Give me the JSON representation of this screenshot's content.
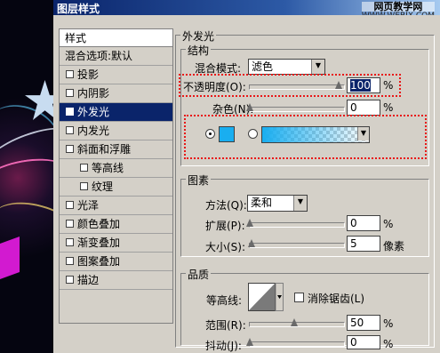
{
  "window": {
    "title": "图层样式"
  },
  "watermark": {
    "line1": "网页教学网",
    "line2": "WWW.WEBJX.COM"
  },
  "styles_list": {
    "header": "样式",
    "items": [
      {
        "label": "混合选项:默认",
        "checkbox": false,
        "checked": false,
        "indent": false,
        "selected": false
      },
      {
        "label": "投影",
        "checkbox": true,
        "checked": false,
        "indent": false,
        "selected": false
      },
      {
        "label": "内阴影",
        "checkbox": true,
        "checked": false,
        "indent": false,
        "selected": false
      },
      {
        "label": "外发光",
        "checkbox": true,
        "checked": true,
        "indent": false,
        "selected": true
      },
      {
        "label": "内发光",
        "checkbox": true,
        "checked": false,
        "indent": false,
        "selected": false
      },
      {
        "label": "斜面和浮雕",
        "checkbox": true,
        "checked": false,
        "indent": false,
        "selected": false
      },
      {
        "label": "等高线",
        "checkbox": true,
        "checked": false,
        "indent": true,
        "selected": false
      },
      {
        "label": "纹理",
        "checkbox": true,
        "checked": false,
        "indent": true,
        "selected": false
      },
      {
        "label": "光泽",
        "checkbox": true,
        "checked": false,
        "indent": false,
        "selected": false
      },
      {
        "label": "颜色叠加",
        "checkbox": true,
        "checked": false,
        "indent": false,
        "selected": false
      },
      {
        "label": "渐变叠加",
        "checkbox": true,
        "checked": false,
        "indent": false,
        "selected": false
      },
      {
        "label": "图案叠加",
        "checkbox": true,
        "checked": false,
        "indent": false,
        "selected": false
      },
      {
        "label": "描边",
        "checkbox": true,
        "checked": false,
        "indent": false,
        "selected": false
      }
    ]
  },
  "outer_glow": {
    "title": "外发光",
    "structure": {
      "title": "结构",
      "blend_mode": {
        "label": "混合模式:",
        "value": "滤色"
      },
      "opacity": {
        "label": "不透明度(O):",
        "value": "100",
        "unit": "%",
        "level": 100
      },
      "noise": {
        "label": "杂色(N):",
        "value": "0",
        "unit": "%",
        "level": 0
      },
      "color_swatch": "#19aef0",
      "gradient_from": "#19aef0"
    },
    "elements": {
      "title": "图素",
      "technique": {
        "label": "方法(Q):",
        "value": "柔和"
      },
      "spread": {
        "label": "扩展(P):",
        "value": "0",
        "unit": "%",
        "level": 0
      },
      "size": {
        "label": "大小(S):",
        "value": "5",
        "unit": "像素",
        "level": 2
      }
    },
    "quality": {
      "title": "品质",
      "contour": {
        "label": "等高线:"
      },
      "anti_aliased": {
        "label": "消除锯齿(L)",
        "checked": false
      },
      "range": {
        "label": "范围(R):",
        "value": "50",
        "unit": "%",
        "level": 50
      },
      "jitter": {
        "label": "抖动(J):",
        "value": "0",
        "unit": "%",
        "level": 0
      }
    }
  }
}
